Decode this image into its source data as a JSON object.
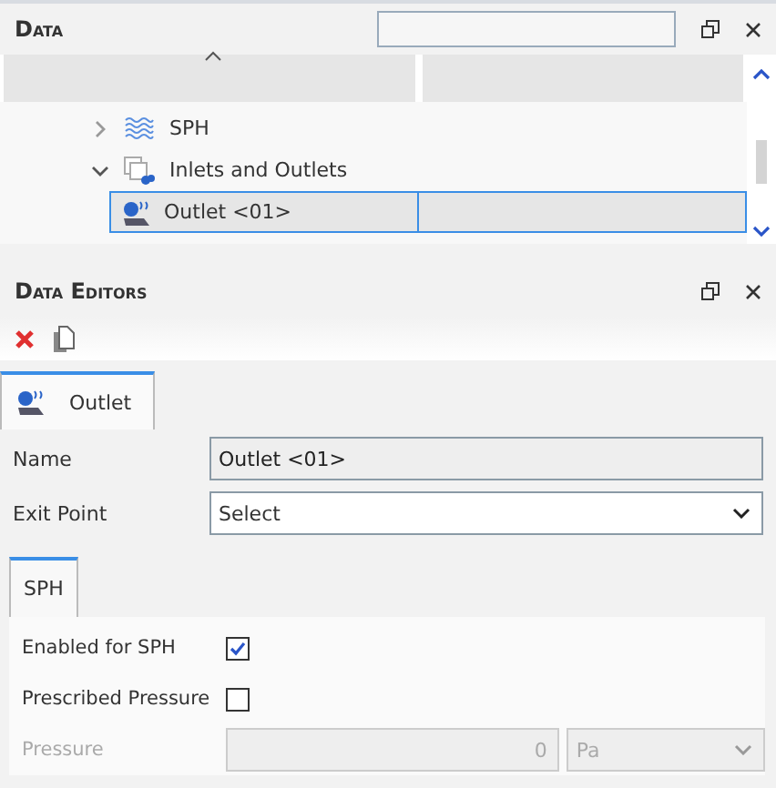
{
  "data_panel": {
    "title": "Data",
    "tree": [
      {
        "label": "SPH",
        "kind": "sph",
        "expanded": false,
        "selected": false
      },
      {
        "label": "Inlets and Outlets",
        "kind": "group",
        "expanded": true,
        "selected": false,
        "children": [
          {
            "label": "Outlet <01>",
            "kind": "outlet",
            "selected": true
          }
        ]
      }
    ]
  },
  "editors_panel": {
    "title": "Data Editors",
    "tabs": [
      {
        "label": "Outlet",
        "selected": true
      }
    ],
    "fields": [
      {
        "label": "Name",
        "kind": "text",
        "value": "Outlet <01>"
      },
      {
        "label": "Exit Point",
        "kind": "select",
        "value": "Select"
      }
    ],
    "subtabs": [
      {
        "label": "SPH",
        "selected": true
      }
    ],
    "options": [
      {
        "label": "Enabled for SPH",
        "kind": "checkbox",
        "checked": true,
        "disabled": false
      },
      {
        "label": "Prescribed Pressure",
        "kind": "checkbox",
        "checked": false,
        "disabled": false
      },
      {
        "label": "Pressure",
        "kind": "quantity",
        "value": "0",
        "unit": "Pa",
        "disabled": true
      }
    ]
  }
}
